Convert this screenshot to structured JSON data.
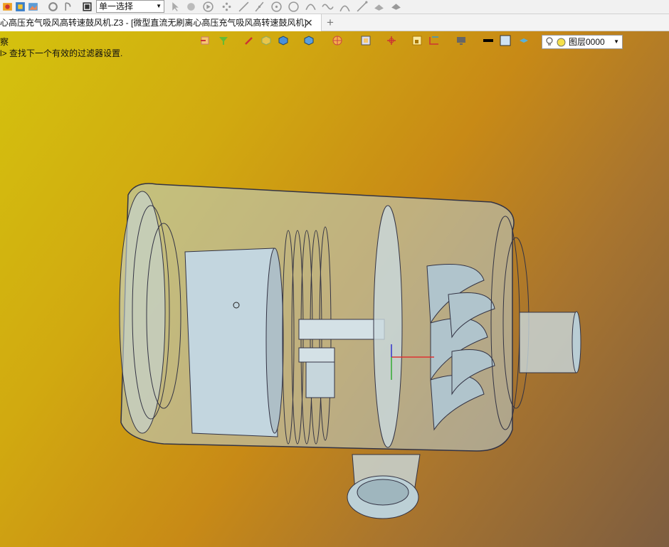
{
  "toolbar": {
    "select_mode": "单一选择",
    "icons": [
      "render-icon",
      "palette-icon",
      "image-icon",
      "gear-icon",
      "timer-icon",
      "stop-icon",
      "pointer-icon",
      "pick-icon",
      "play-icon",
      "points-icon",
      "line-icon",
      "slash-line-icon",
      "circle-dot-icon",
      "circle-icon",
      "curve-icon",
      "wave-icon",
      "arc-icon",
      "spline-icon",
      "cloud-icon",
      "surface-icon"
    ]
  },
  "tabs": {
    "active_title": "心高压充气吸风高转速鼓风机.Z3 - [微型直流无刷离心高压充气吸风高转速鼓风机]",
    "close_glyph": "✕",
    "add_glyph": "+"
  },
  "viewport": {
    "mode_label": "察",
    "message": "l> 查找下一个有效的过滤器设置.",
    "layer_label": "图层0000"
  },
  "colors": {
    "bg_top": "#d4c20e",
    "bg_bottom": "#7d5d40",
    "model": "#b8ccd4"
  }
}
